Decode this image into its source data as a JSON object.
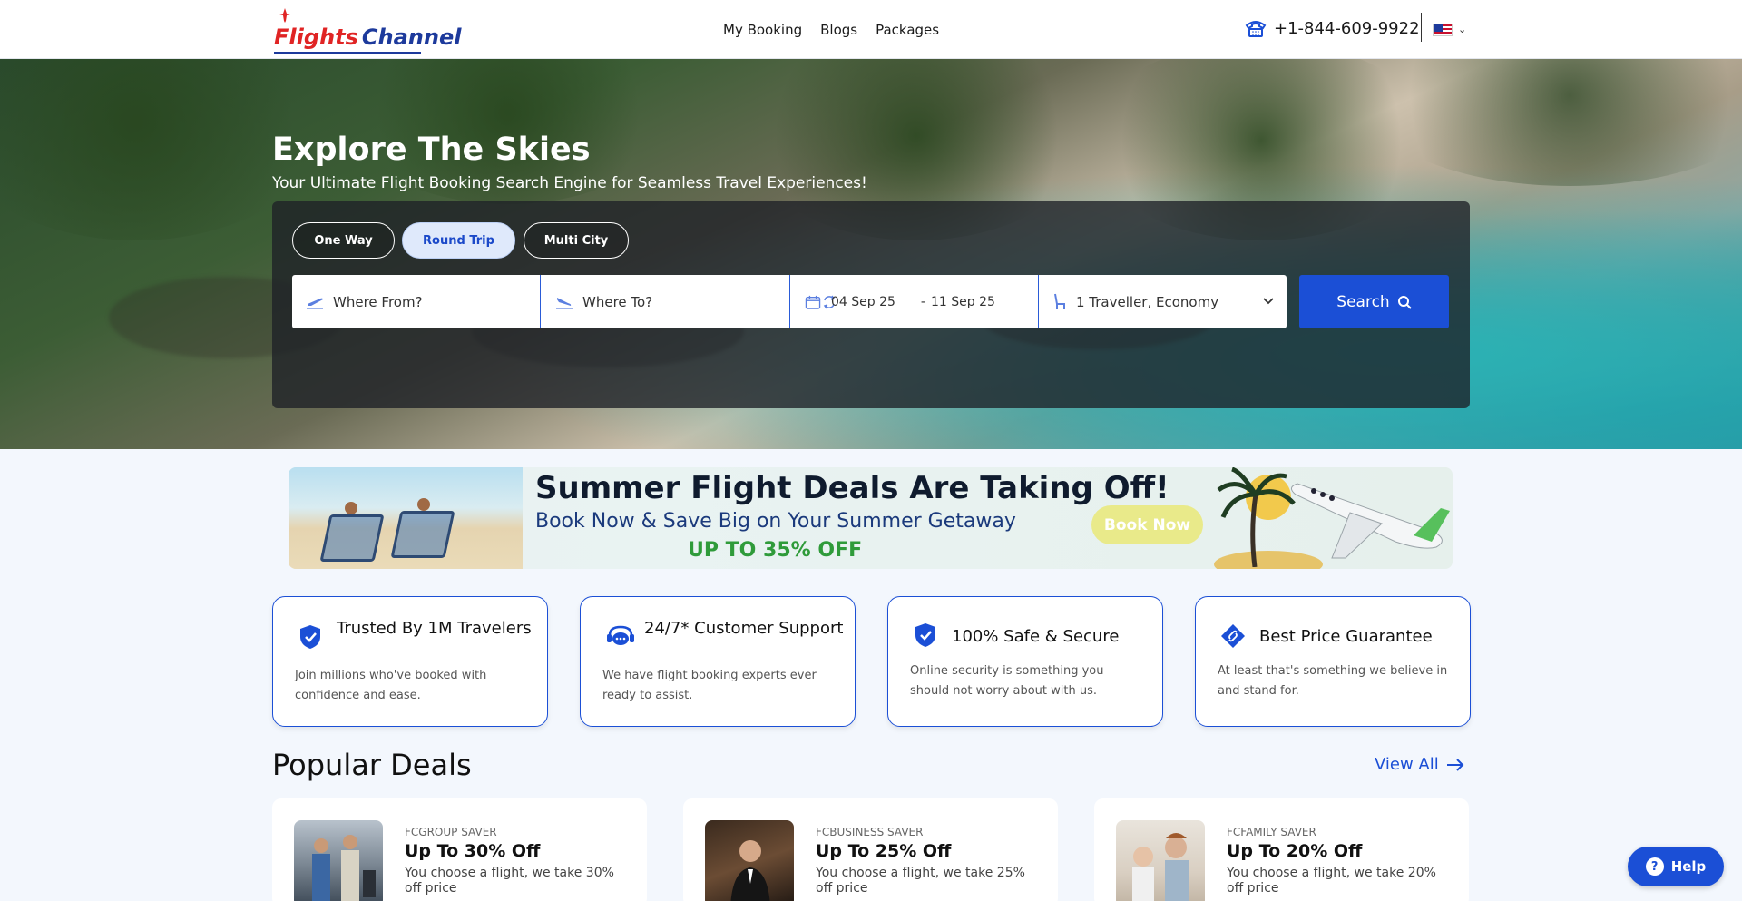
{
  "header": {
    "logo_part1": "Flights",
    "logo_part2": "Channel",
    "nav": [
      "My Booking",
      "Blogs",
      "Packages"
    ],
    "phone": "+1-844-609-9922",
    "flag_icon": "us-flag-icon"
  },
  "hero": {
    "title": "Explore The Skies",
    "subtitle": "Your Ultimate Flight Booking Search Engine for Seamless Travel Experiences!",
    "trip_types": [
      "One Way",
      "Round Trip",
      "Multi City"
    ],
    "active_trip": "Round Trip",
    "from_placeholder": "Where From?",
    "to_placeholder": "Where To?",
    "depart_date": "04 Sep 25",
    "date_separator": "-",
    "return_date": "11 Sep 25",
    "travellers": "1 Traveller, Economy",
    "search_label": "Search"
  },
  "banner": {
    "title": "Summer Flight Deals Are Taking Off!",
    "subtitle": "Book Now & Save Big on Your Summer Getaway",
    "discount": "UP TO 35% OFF",
    "cta": "Book Now"
  },
  "features": [
    {
      "title": "Trusted By 1M Travelers",
      "desc": "Join millions who've booked with confidence and ease.",
      "icon": "shield-check-icon"
    },
    {
      "title": "24/7* Customer Support",
      "desc": "We have flight booking experts ever ready to assist.",
      "icon": "support-chat-icon"
    },
    {
      "title": "100% Safe & Secure",
      "desc": "Online security is something you should not worry about with us.",
      "icon": "shield-check-icon"
    },
    {
      "title": "Best Price Guarantee",
      "desc": "At least that's something we believe in and stand for.",
      "icon": "price-tag-icon"
    }
  ],
  "deals": {
    "title": "Popular Deals",
    "view_all": "View All",
    "items": [
      {
        "code": "FCGROUP SAVER",
        "title": "Up To 30% Off",
        "desc": "You choose a flight, we take 30% off price"
      },
      {
        "code": "FCBUSINESS SAVER",
        "title": "Up To 25% Off",
        "desc": "You choose a flight, we take 25% off price"
      },
      {
        "code": "FCFAMILY SAVER",
        "title": "Up To 20% Off",
        "desc": "You choose a flight, we take 20% off price"
      }
    ]
  },
  "help": {
    "label": "Help",
    "icon_glyph": "?"
  }
}
